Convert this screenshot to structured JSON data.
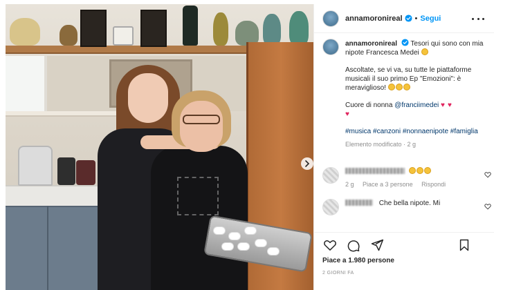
{
  "post": {
    "author": "annamoronireal",
    "follow_label": "Segui",
    "separator": "•",
    "caption": {
      "username": "annamoronireal",
      "line1": "Tesori qui sono con mia nipote Francesca Medei",
      "line2": "Ascoltate, se vi va, su tutte le piattaforme musicali il suo primo Ep \"Emozioni\": è meraviglioso!",
      "line3_prefix": "Cuore di nonna",
      "line3_mention": "@franciimedei",
      "hashtags": "#musica #canzoni #nonnaenipote #famiglia",
      "meta": "Elemento modificato · 2 g"
    },
    "comments": [
      {
        "time": "2 g",
        "likes": "Piace a 3 persone",
        "reply": "Rispondi"
      },
      {
        "text": "Che bella nipote. Mi"
      }
    ],
    "likes_text": "Piace a 1.980 persone",
    "date_text": "2 GIORNI FA"
  },
  "icons": {
    "verified": "verified-badge-icon",
    "more": "more-options-icon",
    "like": "heart-icon",
    "comment": "comment-icon",
    "share": "share-icon",
    "save": "bookmark-icon",
    "next": "chevron-right-icon"
  },
  "colors": {
    "link": "#0095f6",
    "hashtag": "#00376b",
    "muted": "#8e8e8e",
    "text": "#262626"
  }
}
